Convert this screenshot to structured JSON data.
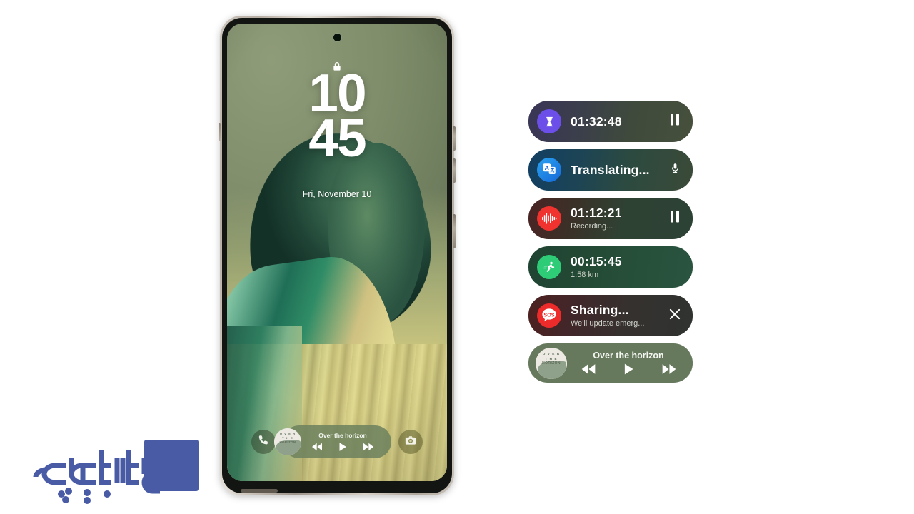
{
  "page": {
    "kind": "samsung-galaxy-live-notifications-promo",
    "background_color": "#ffffff"
  },
  "phone": {
    "device_name": "galaxy-smartphone-mockup",
    "lock_screen": {
      "lock_icon": "lock-icon",
      "camera_punch_hole": "front-camera",
      "time_hours": "10",
      "time_minutes": "45",
      "date": "Fri, November 10",
      "shortcut_left": "phone-icon",
      "shortcut_right": "camera-icon"
    },
    "mini_player": {
      "album_art_lines": [
        "O V E R",
        "T H E",
        "HORIZON"
      ],
      "title": "Over the horizon",
      "controls": [
        "rewind-icon",
        "play-icon",
        "fast-forward-icon"
      ]
    }
  },
  "live_widgets": {
    "heading": "",
    "items": [
      {
        "id": "timer",
        "icon": "hourglass-icon",
        "icon_color": "#6b4fe8",
        "title": "01:32:48",
        "subtitle": "",
        "action": "pause-icon"
      },
      {
        "id": "translate",
        "icon": "translate-icon",
        "icon_color": "#1c8ae8",
        "icon_glyph": "A",
        "title": "Translating...",
        "subtitle": "",
        "action": "microphone-icon"
      },
      {
        "id": "voice-recorder",
        "icon": "waveform-icon",
        "icon_color": "#f0332f",
        "title": "01:12:21",
        "subtitle": "Recording...",
        "action": "pause-icon"
      },
      {
        "id": "running-workout",
        "icon": "running-person-icon",
        "icon_color": "#2ecc77",
        "title": "00:15:45",
        "subtitle": "1.58 km",
        "action": ""
      },
      {
        "id": "emergency-sharing",
        "icon": "sos-icon",
        "icon_color": "#ee2b2b",
        "icon_glyph": "SOS",
        "title": "Sharing...",
        "subtitle": "We'll update emerg...",
        "action": "close-icon"
      }
    ],
    "music": {
      "id": "music-player",
      "album_art_lines": [
        "O V E R",
        "T H E",
        "HORIZON"
      ],
      "title": "Over the horizon",
      "controls": [
        "rewind-icon",
        "play-icon",
        "fast-forward-icon"
      ],
      "background_color": "#66795d"
    }
  },
  "watermark": {
    "name": "farnama-logo",
    "text": "فارنـــامه",
    "color": "#4a5ba6"
  }
}
